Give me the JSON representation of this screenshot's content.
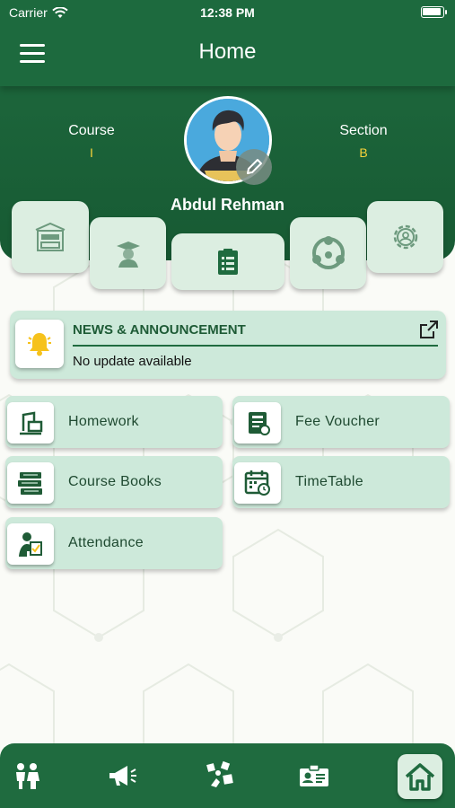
{
  "status_bar": {
    "carrier": "Carrier",
    "time": "12:38 PM"
  },
  "header": {
    "title": "Home"
  },
  "profile": {
    "course_label": "Course",
    "course_value": "I",
    "section_label": "Section",
    "section_value": "B",
    "name": "Abdul Rehman"
  },
  "quick_tiles": [
    {
      "icon": "school-building-icon"
    },
    {
      "icon": "graduate-icon"
    },
    {
      "icon": "document-list-icon"
    },
    {
      "icon": "team-network-icon"
    },
    {
      "icon": "settings-gear-icon"
    }
  ],
  "news": {
    "title": "NEWS & ANNOUNCEMENT",
    "message": "No update available",
    "icon": "bell-icon",
    "link_icon": "external-link-icon"
  },
  "menu": [
    {
      "label": "Homework",
      "icon": "homework-icon"
    },
    {
      "label": "Fee Voucher",
      "icon": "fee-voucher-icon"
    },
    {
      "label": "Course Books",
      "icon": "books-icon"
    },
    {
      "label": "TimeTable",
      "icon": "calendar-clock-icon"
    },
    {
      "label": "Attendance",
      "icon": "attendance-icon"
    }
  ],
  "bottom_nav": [
    {
      "icon": "students-icon"
    },
    {
      "icon": "megaphone-icon"
    },
    {
      "icon": "activities-icon"
    },
    {
      "icon": "id-card-icon"
    },
    {
      "icon": "home-icon",
      "active": true
    }
  ],
  "colors": {
    "primary": "#1f6b3f",
    "card": "#cde9da",
    "tile": "#dceee1",
    "accent_yellow": "#f5d23a"
  }
}
